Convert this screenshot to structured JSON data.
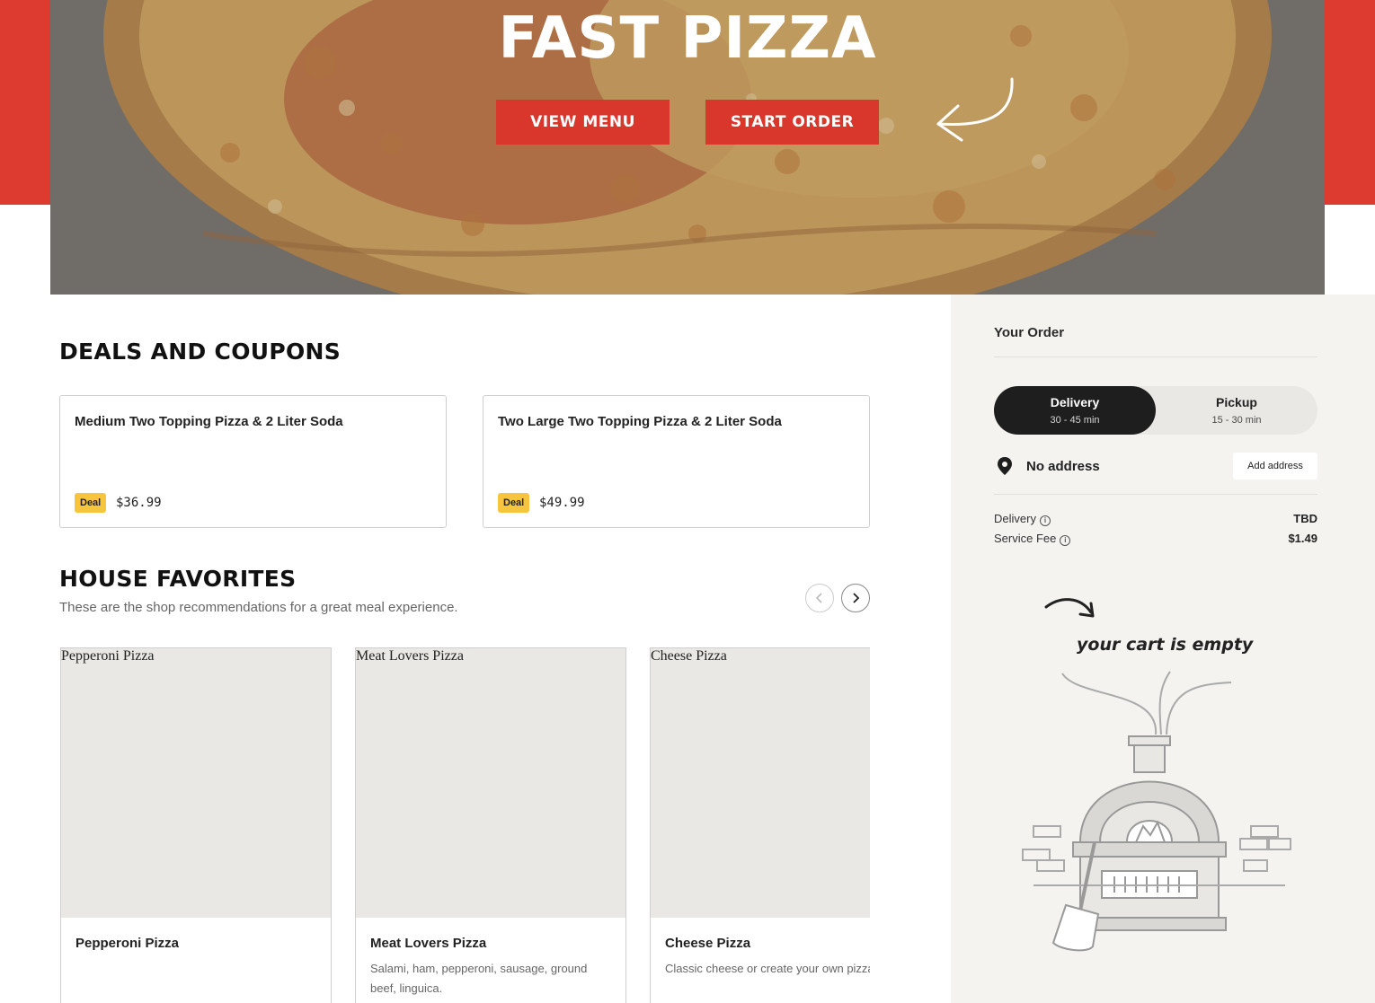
{
  "hero": {
    "title": "FAST PIZZA",
    "view_menu_label": "VIEW MENU",
    "start_order_label": "START ORDER"
  },
  "deals": {
    "title": "DEALS AND COUPONS",
    "items": [
      {
        "name": "Medium Two Topping Pizza & 2 Liter Soda",
        "badge": "Deal",
        "price": "$36.99"
      },
      {
        "name": "Two Large Two Topping Pizza & 2 Liter Soda",
        "badge": "Deal",
        "price": "$49.99"
      }
    ]
  },
  "favorites": {
    "title": "HOUSE FAVORITES",
    "subtitle": "These are the shop recommendations for a great meal experience.",
    "items": [
      {
        "image_alt": "Pepperoni Pizza",
        "name": "Pepperoni Pizza",
        "description": ""
      },
      {
        "image_alt": "Meat Lovers Pizza",
        "name": "Meat Lovers Pizza",
        "description": "Salami, ham, pepperoni, sausage, ground beef, linguica."
      },
      {
        "image_alt": "Cheese Pizza",
        "name": "Cheese Pizza",
        "description": "Classic cheese or create your own pizza."
      }
    ]
  },
  "order_panel": {
    "title": "Your Order",
    "delivery_tab": {
      "label": "Delivery",
      "time": "30 - 45 min"
    },
    "pickup_tab": {
      "label": "Pickup",
      "time": "15 - 30 min"
    },
    "address_text": "No address",
    "add_address_label": "Add address",
    "fees": {
      "delivery_label": "Delivery",
      "delivery_value": "TBD",
      "service_label": "Service Fee",
      "service_value": "$1.49"
    },
    "empty_cart_text": "your cart is empty"
  },
  "colors": {
    "brand_red": "#dd3b30",
    "deal_badge": "#f6c43d",
    "panel_bg": "#f4f3f0",
    "toggle_active": "#1e1e1e"
  },
  "icons": [
    "curved-arrow-icon",
    "map-pin-icon",
    "info-icon",
    "chevron-left-icon",
    "chevron-right-icon",
    "pizza-oven-illustration"
  ]
}
